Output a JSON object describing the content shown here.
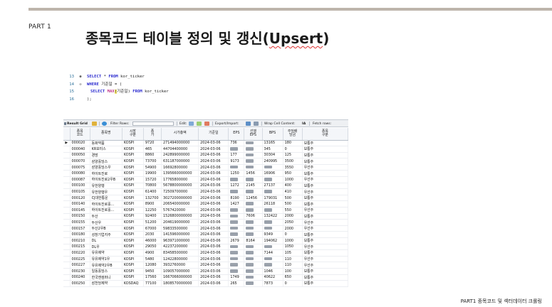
{
  "slide": {
    "part_label": "PART 1",
    "title_main": "종목코드 테이블 정의 및 갱신(",
    "title_word": "Upsert",
    "title_end": ")",
    "footer": "PART1 종목코드 및 섹터데이터 크롤링"
  },
  "editor": {
    "lines": [
      {
        "no": "13",
        "marker": "●",
        "kw1": "SELECT",
        "text1": " * ",
        "kw2": "FROM",
        "text2": " kor_ticker",
        "fn": "",
        "hl": "",
        "text3": "",
        "kw3": "",
        "text4": ""
      },
      {
        "no": "14",
        "marker": "⊖",
        "kw1": "WHERE",
        "text1": " 기준일 = (",
        "kw2": "",
        "text2": "",
        "fn": "",
        "hl": "",
        "text3": "",
        "kw3": "",
        "text4": ""
      },
      {
        "no": "15",
        "marker": "",
        "kw1": "SELECT",
        "text1": " ",
        "kw2": "",
        "text2": "",
        "fn": "MAX",
        "hl": "(",
        "text3": "기준일)",
        "kw3": " FROM",
        "text4": " kor_ticker"
      },
      {
        "no": "16",
        "marker": "",
        "kw1": "",
        "text1": ");",
        "kw2": "",
        "text2": "",
        "fn": "",
        "hl": "",
        "text3": "",
        "kw3": "",
        "text4": ""
      }
    ]
  },
  "toolbar": {
    "result_grid": "Result Grid",
    "filter_rows": "Filter Rows:",
    "edit": "Edit:",
    "export_import": "Export/Import:",
    "wrap_cell": "Wrap Cell Content:",
    "wrap_icon": "IA",
    "fetch_rows": "Fetch rows:"
  },
  "grid": {
    "columns": [
      "종목\n코드",
      "종목명",
      "시장\n구분",
      "종\n가",
      "시가총액",
      "기준일",
      "EPS",
      "선행\nEPS",
      "BPS",
      "주당배\n당금",
      "종목\n구분"
    ],
    "rows": [
      [
        "000020",
        "동화약품",
        "KOSPI",
        "9720",
        "271494000000",
        "2024-03-06",
        "736",
        "NULL",
        "13165",
        "180",
        "보통주"
      ],
      [
        "000040",
        "KR모터스",
        "KOSPI",
        "465",
        "44704400000",
        "2024-03-06",
        "NULL",
        "NULL",
        "345",
        "0",
        "보통주"
      ],
      [
        "000050",
        "경방",
        "KOSPI",
        "8860",
        "242899000000",
        "2024-03-06",
        "177",
        "NULL",
        "30304",
        "125",
        "보통주"
      ],
      [
        "000070",
        "삼양홀딩스",
        "KOSPI",
        "73700",
        "631187000000",
        "2024-03-06",
        "9173",
        "NULL",
        "240995",
        "3500",
        "보통주"
      ],
      [
        "000075",
        "삼양홀딩스우",
        "KOSPI",
        "54900",
        "16692800000",
        "2024-03-06",
        "NULL",
        "NULL",
        "NULL",
        "3550",
        "우선주"
      ],
      [
        "000080",
        "하이트진로",
        "KOSPI",
        "19900",
        "1395660000000",
        "2024-03-06",
        "1250",
        "1456",
        "16906",
        "950",
        "보통주"
      ],
      [
        "000087",
        "하이트진로2우B",
        "KOSPI",
        "15720",
        "17765800000",
        "2024-03-06",
        "NULL",
        "NULL",
        "NULL",
        "1000",
        "우선주"
      ],
      [
        "000100",
        "유한양행",
        "KOSPI",
        "70800",
        "5678800000000",
        "2024-03-06",
        "1272",
        "2145",
        "27137",
        "400",
        "보통주"
      ],
      [
        "000105",
        "유한양행우",
        "KOSPI",
        "61400",
        "72509700000",
        "2024-03-06",
        "NULL",
        "NULL",
        "NULL",
        "410",
        "우선주"
      ],
      [
        "000120",
        "CJ대한통운",
        "KOSPI",
        "132700",
        "3027200000000",
        "2024-03-06",
        "8190",
        "12456",
        "179031",
        "500",
        "보통주"
      ],
      [
        "000140",
        "하이트진로홀...",
        "KOSPI",
        "8900",
        "206540000000",
        "2024-03-06",
        "1427",
        "NULL",
        "26118",
        "500",
        "보통주"
      ],
      [
        "000145",
        "하이트진로홀...",
        "KOSPI",
        "12250",
        "5767420000",
        "2024-03-06",
        "NULL",
        "NULL",
        "NULL",
        "550",
        "우선주"
      ],
      [
        "000150",
        "두산",
        "KOSPI",
        "92400",
        "1526800000000",
        "2024-03-06",
        "NULL",
        "7606",
        "132422",
        "2000",
        "보통주"
      ],
      [
        "000155",
        "두산우",
        "KOSPI",
        "51200",
        "204619000000",
        "2024-03-06",
        "NULL",
        "NULL",
        "NULL",
        "2050",
        "우선주"
      ],
      [
        "000157",
        "두산2우B",
        "KOSPI",
        "67000",
        "59833500000",
        "2024-03-06",
        "NULL",
        "NULL",
        "NULL",
        "2000",
        "우선주"
      ],
      [
        "000180",
        "성창기업지주",
        "KOSPI",
        "2030",
        "141596000000",
        "2024-03-06",
        "NULL",
        "NULL",
        "9349",
        "0",
        "보통주"
      ],
      [
        "000210",
        "DL",
        "KOSPI",
        "46000",
        "963971000000",
        "2024-03-06",
        "2679",
        "8164",
        "194062",
        "1000",
        "보통주"
      ],
      [
        "000215",
        "DL우",
        "KOSPI",
        "29050",
        "42237200000",
        "2024-03-06",
        "NULL",
        "NULL",
        "NULL",
        "1050",
        "우선주"
      ],
      [
        "000220",
        "유유제약",
        "KOSPI",
        "4900",
        "83458500000",
        "2024-03-06",
        "NULL",
        "NULL",
        "7144",
        "105",
        "보통주"
      ],
      [
        "000225",
        "유유제약1우",
        "KOSPI",
        "5480",
        "12422800000",
        "2024-03-06",
        "NULL",
        "NULL",
        "NULL",
        "110",
        "우선주"
      ],
      [
        "000227",
        "유유제약2우B",
        "KOSPI",
        "12080",
        "3932760000",
        "2024-03-06",
        "NULL",
        "NULL",
        "NULL",
        "110",
        "우선주"
      ],
      [
        "000230",
        "일동홀딩스",
        "KOSPI",
        "9450",
        "109057000000",
        "2024-03-06",
        "NULL",
        "NULL",
        "1046",
        "100",
        "보통주"
      ],
      [
        "000240",
        "한국앤컴퍼니",
        "KOSPI",
        "17560",
        "1667066000000",
        "2024-03-06",
        "1749",
        "NULL",
        "40622",
        "650",
        "보통주"
      ],
      [
        "000250",
        "삼천당제약",
        "KOSDAQ",
        "77100",
        "1808570000000",
        "2024-03-06",
        "265",
        "NULL",
        "7873",
        "0",
        "보통주"
      ]
    ]
  },
  "colors": {
    "rule": "#bdb5ab",
    "keyword": "#2a2acf",
    "function": "#c23b8c",
    "null_badge": "#9aa1ab"
  }
}
